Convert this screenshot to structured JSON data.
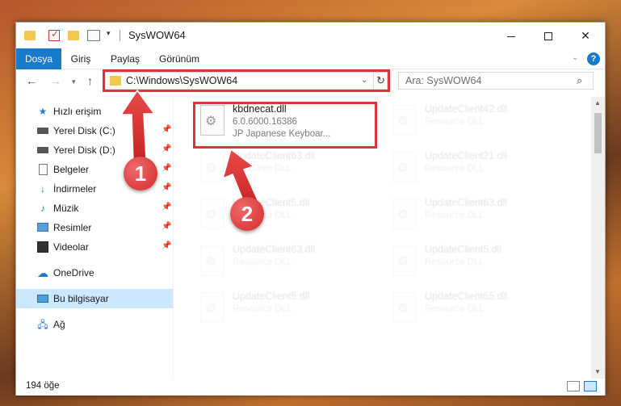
{
  "window": {
    "title": "SysWOW64",
    "minimize_icon": "minimize-icon",
    "maximize_icon": "maximize-icon",
    "close_symbol": "✕"
  },
  "ribbon": {
    "tabs": [
      {
        "label": "Dosya",
        "active": true
      },
      {
        "label": "Giriş"
      },
      {
        "label": "Paylaş"
      },
      {
        "label": "Görünüm"
      }
    ],
    "help_symbol": "?"
  },
  "address_bar": {
    "path": "C:\\Windows\\SysWOW64",
    "refresh_symbol": "↻"
  },
  "search": {
    "placeholder": "Ara: SysWOW64",
    "icon": "search-icon"
  },
  "sidebar": {
    "items": [
      {
        "label": "Hızlı erişim",
        "icon": "star-icon",
        "pinned": false
      },
      {
        "label": "Yerel Disk (C:)",
        "icon": "disk-icon",
        "pinned": true
      },
      {
        "label": "Yerel Disk (D:)",
        "icon": "disk-icon",
        "pinned": true
      },
      {
        "label": "Belgeler",
        "icon": "document-icon",
        "pinned": true
      },
      {
        "label": "İndirmeler",
        "icon": "download-icon",
        "pinned": true
      },
      {
        "label": "Müzik",
        "icon": "music-icon",
        "pinned": true
      },
      {
        "label": "Resimler",
        "icon": "picture-icon",
        "pinned": true
      },
      {
        "label": "Videolar",
        "icon": "video-icon",
        "pinned": true
      },
      {
        "label": "OneDrive",
        "icon": "cloud-icon"
      },
      {
        "label": "Bu bilgisayar",
        "icon": "computer-icon",
        "selected": true
      },
      {
        "label": "Ağ",
        "icon": "network-icon"
      }
    ]
  },
  "files": [
    {
      "name": "kbdnecat.dll",
      "line1": "6.0.6000.16386",
      "line2": "JP Japanese Keyboar...",
      "highlighted": true
    },
    {
      "name": "UpdateClient42.dll",
      "line1": "Resource DLL"
    },
    {
      "name": "UpdateClient63.dll",
      "line1": "Resource DLL"
    },
    {
      "name": "UpdateClient21.dll",
      "line1": "Resource DLL"
    },
    {
      "name": "UpdateClient5.dll",
      "line1": "Resource DLL"
    },
    {
      "name": "UpdateClient63.dll",
      "line1": "Resource DLL"
    },
    {
      "name": "UpdateClient63.dll",
      "line1": "Resource DLL"
    },
    {
      "name": "UpdateClient5.dll",
      "line1": "Resource DLL"
    },
    {
      "name": "UpdateClient5.dll",
      "line1": "Resource DLL"
    },
    {
      "name": "UpdateClient65.dll",
      "line1": "Resource DLL"
    }
  ],
  "status": {
    "count": "194 öğe"
  },
  "callouts": {
    "one": "1",
    "two": "2"
  },
  "colors": {
    "accent": "#1979ca",
    "highlight_red": "#d9353a",
    "selected_bg": "#cce8ff"
  }
}
